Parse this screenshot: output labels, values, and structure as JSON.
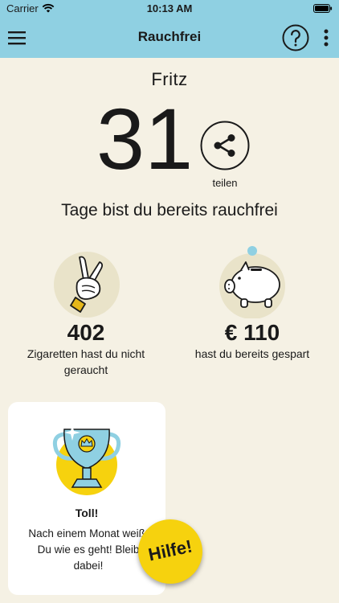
{
  "status_bar": {
    "carrier": "Carrier",
    "time": "10:13 AM"
  },
  "nav": {
    "title": "Rauchfrei"
  },
  "profile": {
    "name": "Fritz"
  },
  "counter": {
    "days": "31",
    "share_label": "teilen",
    "tagline": "Tage bist du bereits rauchfrei"
  },
  "stats": {
    "cigarettes": {
      "value": "402",
      "label_line1": "Zigaretten hast du nicht",
      "label_line2": "geraucht"
    },
    "savings": {
      "value": "€ 110",
      "label": "hast du bereits gespart"
    }
  },
  "achievement": {
    "title": "Toll!",
    "text_line1": "Nach einem Monat weißt",
    "text_line2": "Du wie es geht! Bleib",
    "text_line3": "dabei!"
  },
  "help_button": {
    "label": "Hilfe!"
  },
  "colors": {
    "header": "#8fd0e2",
    "background": "#f5f1e4",
    "accent_yellow": "#f6d20e",
    "icon_circle": "#e9e3c9"
  },
  "icons": [
    "menu-icon",
    "help-icon",
    "more-icon",
    "share-icon",
    "peace-hand-icon",
    "piggy-bank-icon",
    "trophy-icon",
    "wifi-icon",
    "battery-icon"
  ]
}
